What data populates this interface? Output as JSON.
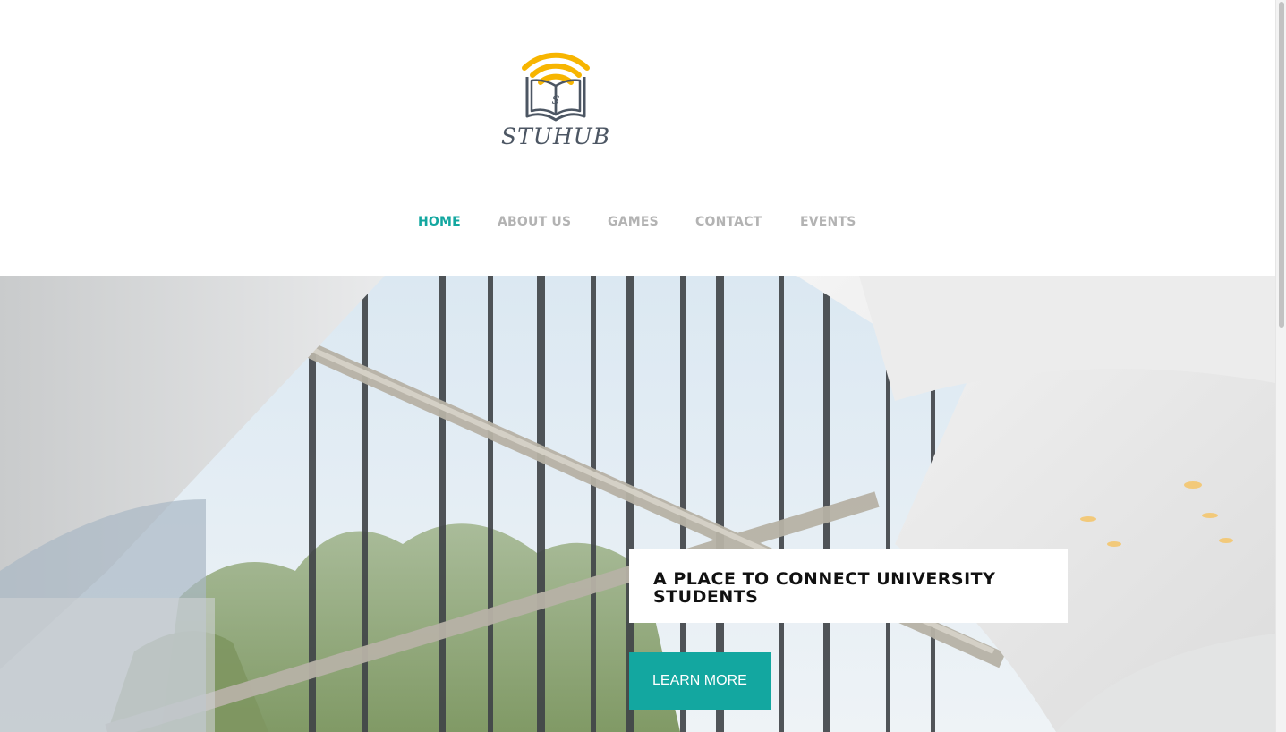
{
  "brand": {
    "logo_text": "STUHUB",
    "logo_letter": "S",
    "icon": "wifi-book-icon",
    "colors": {
      "wifi": "#f7b500",
      "book": "#4c5663"
    }
  },
  "nav": {
    "items": [
      {
        "label": "HOME",
        "active": true
      },
      {
        "label": "ABOUT US",
        "active": false
      },
      {
        "label": "GAMES",
        "active": false
      },
      {
        "label": "CONTACT",
        "active": false
      },
      {
        "label": "EVENTS",
        "active": false
      }
    ]
  },
  "hero": {
    "title": "A PLACE TO CONNECT UNIVERSITY STUDENTS",
    "button_label": "LEARN MORE"
  },
  "colors": {
    "accent": "#13a7a0",
    "nav_inactive": "#b3b3b3",
    "hero_text": "#111111"
  }
}
